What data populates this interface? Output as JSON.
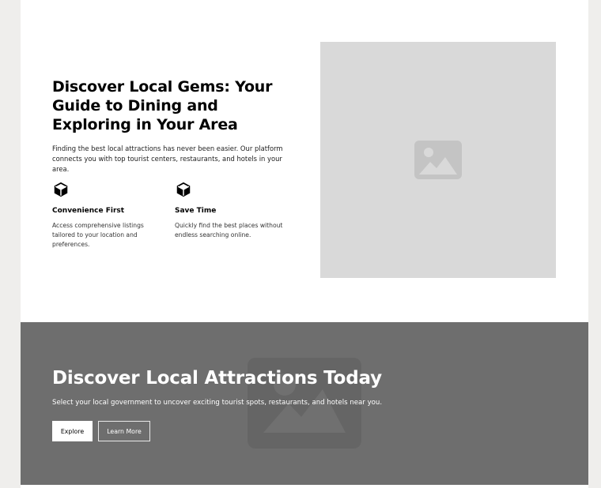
{
  "feature": {
    "headline": "Discover Local Gems: Your Guide to Dining and Exploring in Your Area",
    "lead": "Finding the best local attractions has never been easier. Our platform connects you with top tourist centers, restaurants, and hotels in your area.",
    "benefits": [
      {
        "icon": "cube-icon",
        "title": "Convenience First",
        "description": "Access comprehensive listings tailored to your location and preferences."
      },
      {
        "icon": "cube-icon",
        "title": "Save Time",
        "description": "Quickly find the best places without endless searching online."
      }
    ],
    "image": {
      "icon": "image-placeholder-icon"
    }
  },
  "cta": {
    "title": "Discover Local Attractions Today",
    "subtitle": "Select your local government to uncover exciting tourist spots, restaurants, and hotels near you.",
    "primary_label": "Explore",
    "secondary_label": "Learn More",
    "background_icon": "image-placeholder-icon"
  },
  "colors": {
    "page_background": "#efeeec",
    "content_background": "#ffffff",
    "placeholder": "#d9d9d9",
    "cta_background": "#6e6e6e"
  }
}
